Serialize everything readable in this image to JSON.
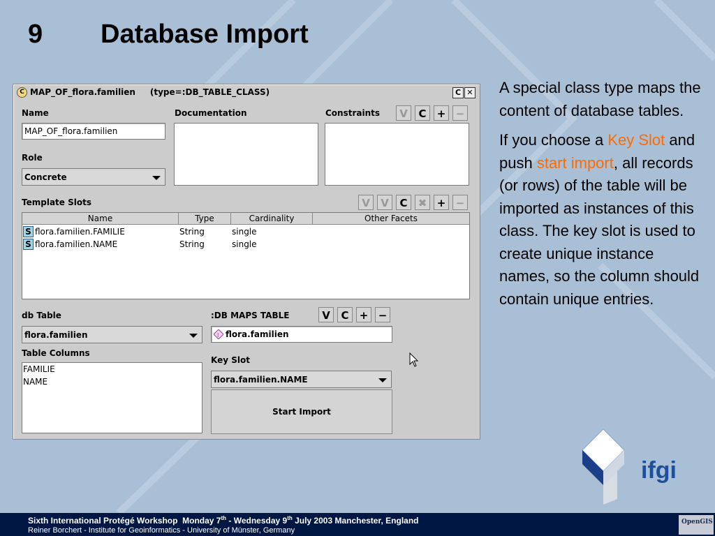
{
  "slide": {
    "number": "9",
    "title": "Database Import"
  },
  "side": {
    "p1": "A special class type maps the content of database tables.",
    "p2_a": "If you choose a ",
    "p2_hl1": "Key Slot",
    "p2_b": " and push ",
    "p2_hl2": "start import",
    "p2_c": ", all records (or rows) of the table will be imported as instances of this class. The key slot is used to create unique instance names, so the column should contain unique entries.",
    "highlight_color": "#ff6a00"
  },
  "window": {
    "icon": "C",
    "title": "MAP_OF_flora.familien     (type=:DB_TABLE_CLASS)",
    "btn_c": "C",
    "btn_x": "✕",
    "name_label": "Name",
    "name_value": "MAP_OF_flora.familien",
    "doc_label": "Documentation",
    "constraints_label": "Constraints",
    "role_label": "Role",
    "role_value": "Concrete",
    "template_slots_label": "Template Slots",
    "columns": [
      "Name",
      "Type",
      "Cardinality",
      "Other Facets"
    ],
    "rows": [
      {
        "badge": "S",
        "name": "flora.familien.FAMILIE",
        "type": "String",
        "card": "single"
      },
      {
        "badge": "S",
        "name": "flora.familien.NAME",
        "type": "String",
        "card": "single"
      }
    ],
    "db_table_label": "db Table",
    "db_table_value": "flora.familien",
    "maps_label": ":DB MAPS TABLE",
    "maps_value": "flora.familien",
    "table_columns_label": "Table Columns",
    "table_columns": [
      "FAMILIE",
      "NAME"
    ],
    "key_slot_label": "Key Slot",
    "key_slot_value": "flora.familien.NAME",
    "start_import": "Start Import",
    "btn_v": "V",
    "btn_plus": "+",
    "btn_minus": "−"
  },
  "logo": {
    "text": "ifgi",
    "badge": "OpenGIS"
  },
  "footer": {
    "line1_a": "Sixth International Protégé Workshop  Monday 7",
    "sup_th": "th",
    "line1_b": " - Wednesday 9",
    "line1_c": " July 2003 Manchester, England",
    "line2": "Reiner Borchert - Institute for Geoinformatics - University of Münster, Germany"
  }
}
